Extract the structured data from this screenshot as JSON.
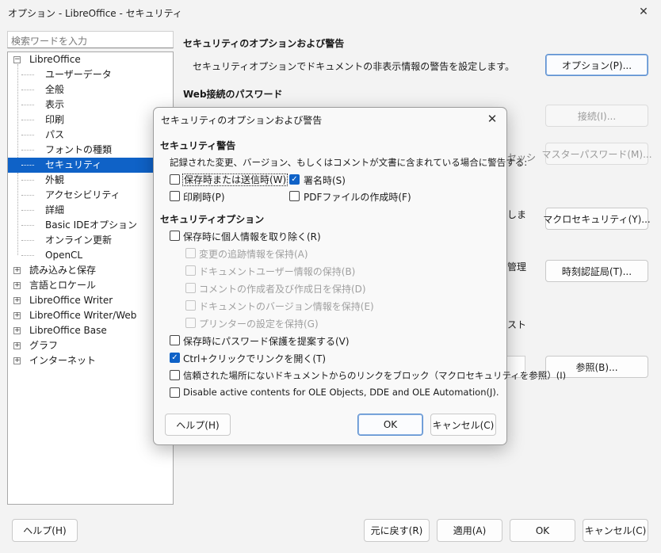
{
  "window": {
    "title": "オプション - LibreOffice - セキュリティ",
    "close": "✕"
  },
  "search": {
    "placeholder": "検索ワードを入力"
  },
  "tree": {
    "root": "LibreOffice",
    "children": [
      "ユーザーデータ",
      "全般",
      "表示",
      "印刷",
      "パス",
      "フォントの種類",
      "セキュリティ",
      "外観",
      "アクセシビリティ",
      "詳細",
      "Basic IDEオプション",
      "オンライン更新",
      "OpenCL"
    ],
    "selected": "セキュリティ",
    "groups": [
      "読み込みと保存",
      "言語とロケール",
      "LibreOffice Writer",
      "LibreOffice Writer/Web",
      "LibreOffice Base",
      "グラフ",
      "インターネット"
    ],
    "collapsed_glyph": "+",
    "expanded_glyph": "−"
  },
  "main": {
    "section1_title": "セキュリティのオプションおよび警告",
    "section1_desc": "セキュリティオプションでドキュメントの非表示情報の警告を設定します。",
    "options_button": "オプション(P)...",
    "section2_title": "Web接続のパスワード",
    "connect_button": "接続(I)...",
    "partial_text1": "セッシ",
    "master_password_button": "マスターパスワード(M)...",
    "partial_text2": "しま",
    "macro_security_button": "マクロセキュリティ(Y)...",
    "partial_text3": "管理",
    "tsa_button": "時刻認証局(T)...",
    "partial_text4": "スト",
    "browse_button": "参照(B)..."
  },
  "footer": {
    "help": "ヘルプ(H)",
    "reset": "元に戻す(R)",
    "apply": "適用(A)",
    "ok": "OK",
    "cancel": "キャンセル(C)"
  },
  "dialog": {
    "title": "セキュリティのオプションおよび警告",
    "close": "✕",
    "warnings_title": "セキュリティ警告",
    "warnings_desc": "記録された変更、バージョン、もしくはコメントが文書に含まれている場合に警告する:",
    "warn_items": [
      {
        "label": "保存時または送信時(W)",
        "checked": false
      },
      {
        "label": "署名時(S)",
        "checked": true
      },
      {
        "label": "印刷時(P)",
        "checked": false
      },
      {
        "label": "PDFファイルの作成時(F)",
        "checked": false
      }
    ],
    "options_title": "セキュリティオプション",
    "remove_personal": {
      "label": "保存時に個人情報を取り除く(R)",
      "checked": false
    },
    "sub_items": [
      {
        "label": "変更の追跡情報を保持(A)",
        "checked": false
      },
      {
        "label": "ドキュメントユーザー情報の保持(B)",
        "checked": false
      },
      {
        "label": "コメントの作成者及び作成日を保持(D)",
        "checked": false
      },
      {
        "label": "ドキュメントのバージョン情報を保持(E)",
        "checked": false
      },
      {
        "label": "プリンターの設定を保持(G)",
        "checked": false
      }
    ],
    "other_items": [
      {
        "label": "保存時にパスワード保護を提案する(V)",
        "checked": false
      },
      {
        "label": "Ctrl+クリックでリンクを開く(T)",
        "checked": true
      },
      {
        "label": "信頼された場所にないドキュメントからのリンクをブロック（マクロセキュリティを参照）(I)",
        "checked": false
      },
      {
        "label": "Disable active contents for OLE Objects, DDE and OLE Automation(J).",
        "checked": false
      }
    ],
    "help": "ヘルプ(H)",
    "ok": "OK",
    "cancel": "キャンセル(C)",
    "check_glyph": "✓"
  }
}
